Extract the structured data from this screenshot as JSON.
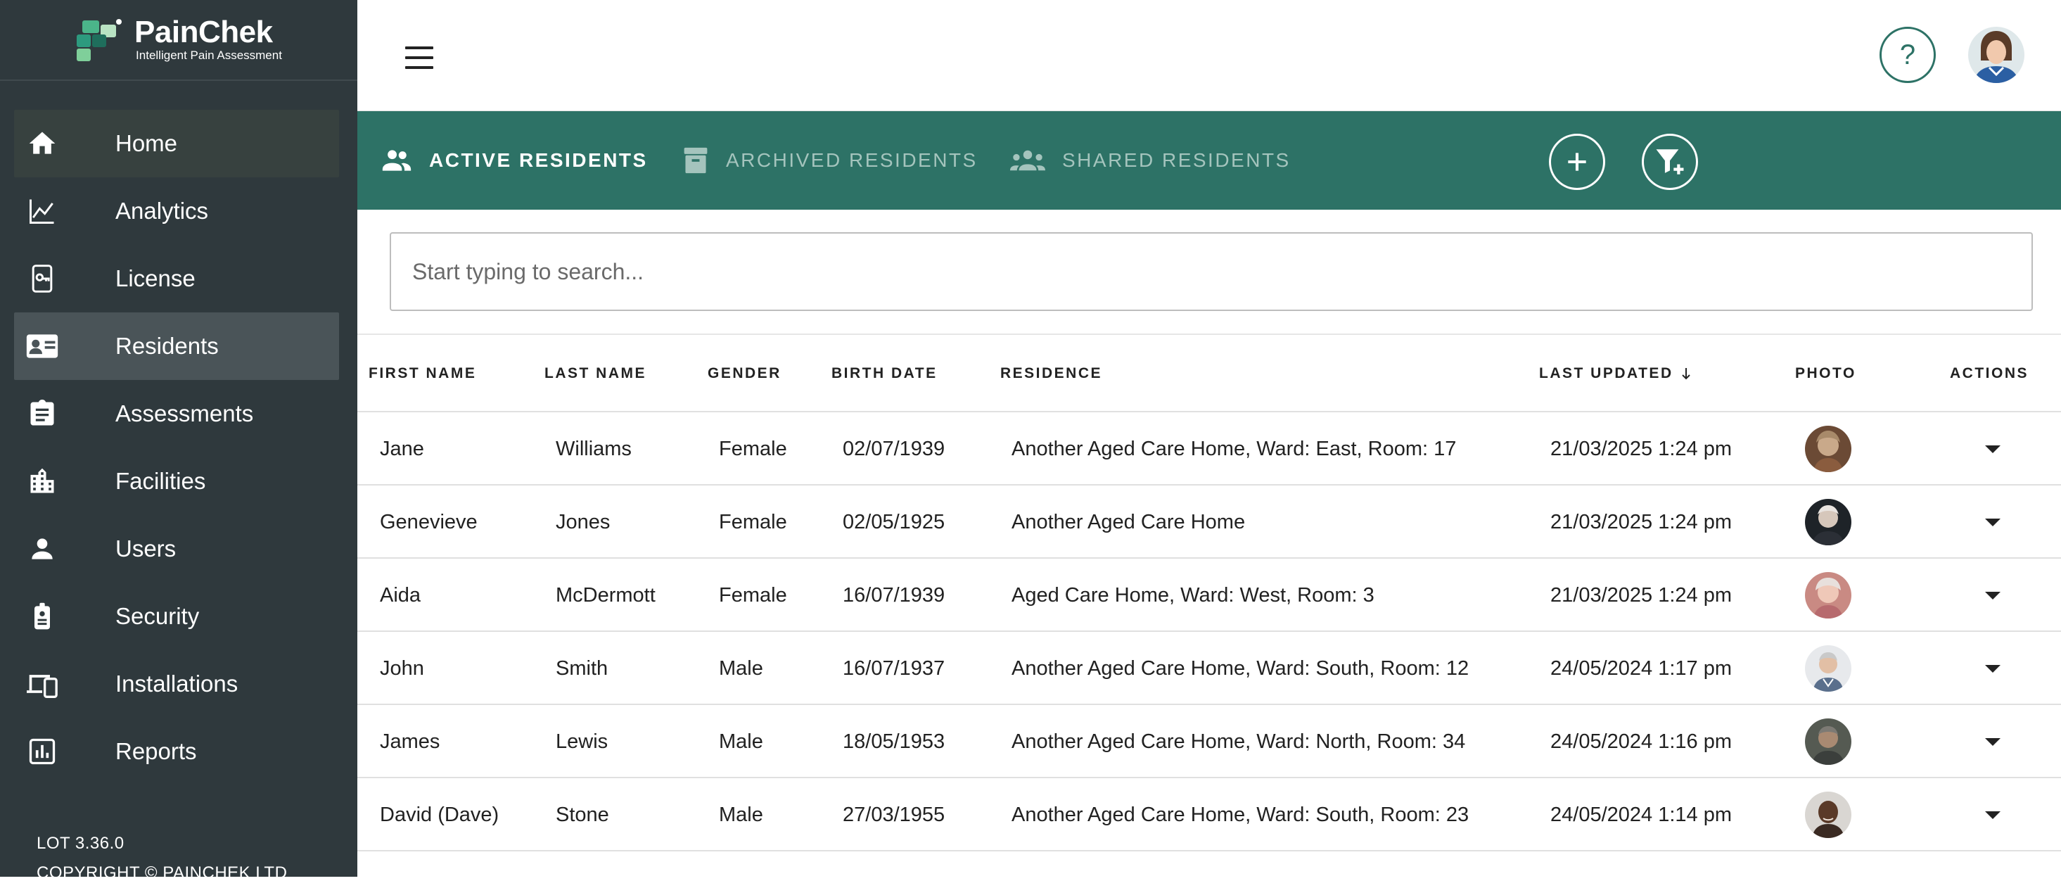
{
  "brand": {
    "name": "PainChek",
    "tagline": "Intelligent Pain Assessment"
  },
  "sidebar": {
    "items": [
      {
        "label": "Home",
        "icon": "home-icon"
      },
      {
        "label": "Analytics",
        "icon": "analytics-icon"
      },
      {
        "label": "License",
        "icon": "license-icon"
      },
      {
        "label": "Residents",
        "icon": "residents-icon",
        "selected": true
      },
      {
        "label": "Assessments",
        "icon": "assessments-icon"
      },
      {
        "label": "Facilities",
        "icon": "facilities-icon"
      },
      {
        "label": "Users",
        "icon": "users-icon"
      },
      {
        "label": "Security",
        "icon": "security-icon"
      },
      {
        "label": "Installations",
        "icon": "installations-icon"
      },
      {
        "label": "Reports",
        "icon": "reports-icon"
      }
    ],
    "version": "LOT 3.36.0",
    "copyright": "COPYRIGHT © PAINCHEK LTD"
  },
  "header": {
    "help_label": "?"
  },
  "tabs": [
    {
      "label": "ACTIVE RESIDENTS",
      "icon": "people-icon",
      "active": true
    },
    {
      "label": "ARCHIVED RESIDENTS",
      "icon": "archive-icon",
      "active": false
    },
    {
      "label": "SHARED RESIDENTS",
      "icon": "shared-people-icon",
      "active": false
    }
  ],
  "search": {
    "placeholder": "Start typing to search...",
    "value": ""
  },
  "table": {
    "columns": [
      "FIRST NAME",
      "LAST NAME",
      "GENDER",
      "BIRTH DATE",
      "RESIDENCE",
      "LAST UPDATED",
      "PHOTO",
      "ACTIONS"
    ],
    "sort": {
      "column": "LAST UPDATED",
      "direction": "descending"
    },
    "rows": [
      {
        "first": "Jane",
        "last": "Williams",
        "gender": "Female",
        "birth": "02/07/1939",
        "residence": "Another Aged Care Home, Ward: East, Room: 17",
        "updated": "21/03/2025 1:24 pm"
      },
      {
        "first": "Genevieve",
        "last": "Jones",
        "gender": "Female",
        "birth": "02/05/1925",
        "residence": "Another Aged Care Home",
        "updated": "21/03/2025 1:24 pm"
      },
      {
        "first": "Aida",
        "last": "McDermott",
        "gender": "Female",
        "birth": "16/07/1939",
        "residence": "Aged Care Home, Ward: West, Room: 3",
        "updated": "21/03/2025 1:24 pm"
      },
      {
        "first": "John",
        "last": "Smith",
        "gender": "Male",
        "birth": "16/07/1937",
        "residence": "Another Aged Care Home, Ward: South, Room: 12",
        "updated": "24/05/2024 1:17 pm"
      },
      {
        "first": "James",
        "last": "Lewis",
        "gender": "Male",
        "birth": "18/05/1953",
        "residence": "Another Aged Care Home, Ward: North, Room: 34",
        "updated": "24/05/2024 1:16 pm"
      },
      {
        "first": "David (Dave)",
        "last": "Stone",
        "gender": "Male",
        "birth": "27/03/1955",
        "residence": "Another Aged Care Home, Ward: South, Room: 23",
        "updated": "24/05/2024 1:14 pm"
      }
    ]
  },
  "colors": {
    "sidebar": "#2f393d",
    "sidebar_selected": "#4a5458",
    "accent": "#2d7266",
    "tab_inactive": "#a4c4bd"
  }
}
